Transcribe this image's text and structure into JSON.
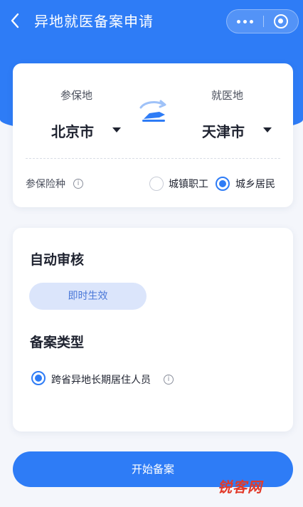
{
  "nav": {
    "back_icon": "chevron-left-icon",
    "title": "异地就医备案申请",
    "more_icon": "more-dots-icon",
    "close_icon": "target-icon"
  },
  "location": {
    "insured_label": "参保地",
    "insured_value": "北京市",
    "medical_label": "就医地",
    "medical_value": "天津市",
    "swap_icon": "plane-swap-icon"
  },
  "insurance": {
    "label": "参保险种",
    "options": [
      {
        "label": "城镇职工",
        "selected": false
      },
      {
        "label": "城乡居民",
        "selected": true
      }
    ]
  },
  "review": {
    "title": "自动审核",
    "badge": "即时生效"
  },
  "filing": {
    "title": "备案类型",
    "options": [
      {
        "label": "跨省异地长期居住人员",
        "selected": true
      }
    ]
  },
  "actions": {
    "start": "开始备案"
  },
  "watermark": "锐客网",
  "colors": {
    "primary": "#2e7cf6",
    "badge_bg": "#dbe5fb",
    "badge_text": "#4a78d8"
  }
}
